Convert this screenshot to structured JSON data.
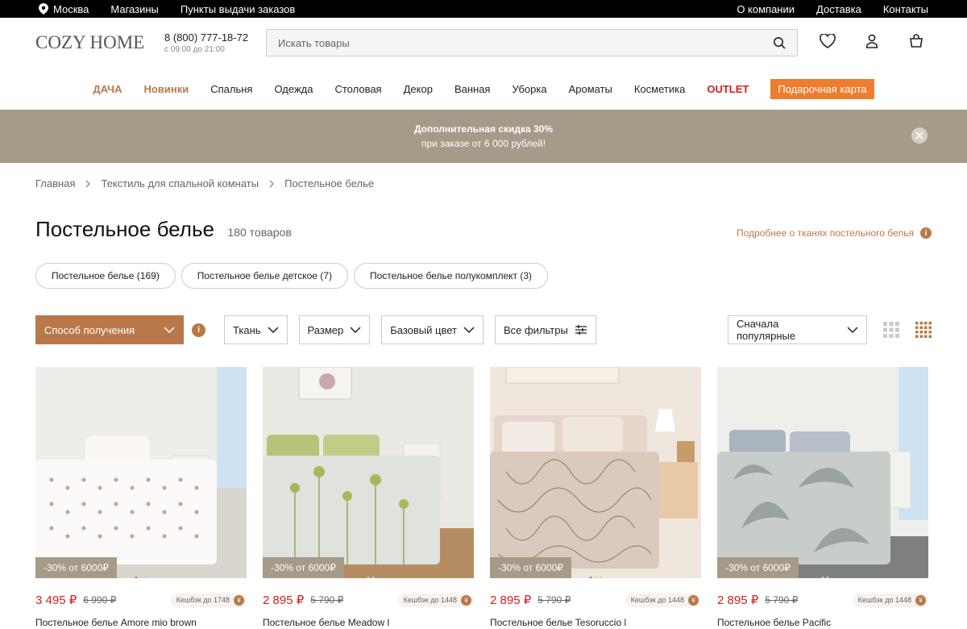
{
  "topbar": {
    "city": "Москва",
    "stores": "Магазины",
    "pickup": "Пункты выдачи заказов",
    "about": "О компании",
    "delivery": "Доставка",
    "contacts": "Контакты"
  },
  "header": {
    "logo": "COZY HOME",
    "phone": "8 (800) 777-18-72",
    "hours": "с 09:00 до 21:00",
    "search_placeholder": "Искать товары"
  },
  "nav": {
    "items": [
      "ДАЧА",
      "Новинки",
      "Спальня",
      "Одежда",
      "Столовая",
      "Декор",
      "Ванная",
      "Уборка",
      "Ароматы",
      "Косметика",
      "OUTLET",
      "Подарочная карта"
    ]
  },
  "promo": {
    "line1": "Дополнительная скидка 30%",
    "line2": "при заказе от 6 000 рублей!"
  },
  "breadcrumbs": [
    "Главная",
    "Текстиль для спальной комнаты",
    "Постельное белье"
  ],
  "page": {
    "title": "Постельное белье",
    "count": "180 товаров",
    "fabric_link": "Подробнее о тканях постельного белья"
  },
  "chips": [
    "Постельное белье (169)",
    "Постельное белье детское (7)",
    "Постельное белье полукомплект (3)"
  ],
  "filters": {
    "delivery": "Способ получения",
    "fabric": "Ткань",
    "size": "Размер",
    "color": "Базовый цвет",
    "all": "Все фильтры",
    "sort": "Сначала популярные"
  },
  "colors": {
    "accent": "#b9784a",
    "promo_bg": "#a69a88",
    "sale": "#d41e1e",
    "gift": "#ef7d2e"
  },
  "products": [
    {
      "badge": "-30% от 6000₽",
      "price": "3 495 ₽",
      "old": "6 990 ₽",
      "cashback": "Кешбэк до 1748",
      "name": "Постельное белье Amore mio brown",
      "bg": "#ecebe8",
      "pattern": "hearts"
    },
    {
      "badge": "-30% от 6000₽",
      "price": "2 895 ₽",
      "old": "5 790 ₽",
      "cashback": "Кешбэк до 1448",
      "name": "Постельное белье Meadow l",
      "bg": "#e9e8e2",
      "pattern": "meadow"
    },
    {
      "badge": "-30% от 6000₽",
      "price": "2 895 ₽",
      "old": "5 790 ₽",
      "cashback": "Кешбэк до 1448",
      "name": "Постельное белье Tesoruccio l",
      "bg": "#efe8e0",
      "pattern": "tesoro"
    },
    {
      "badge": "-30% от 6000₽",
      "price": "2 895 ₽",
      "old": "5 790 ₽",
      "cashback": "Кешбэк до 1448",
      "name": "Постельное белье Pacific",
      "bg": "#ecece9",
      "pattern": "pacific"
    }
  ]
}
